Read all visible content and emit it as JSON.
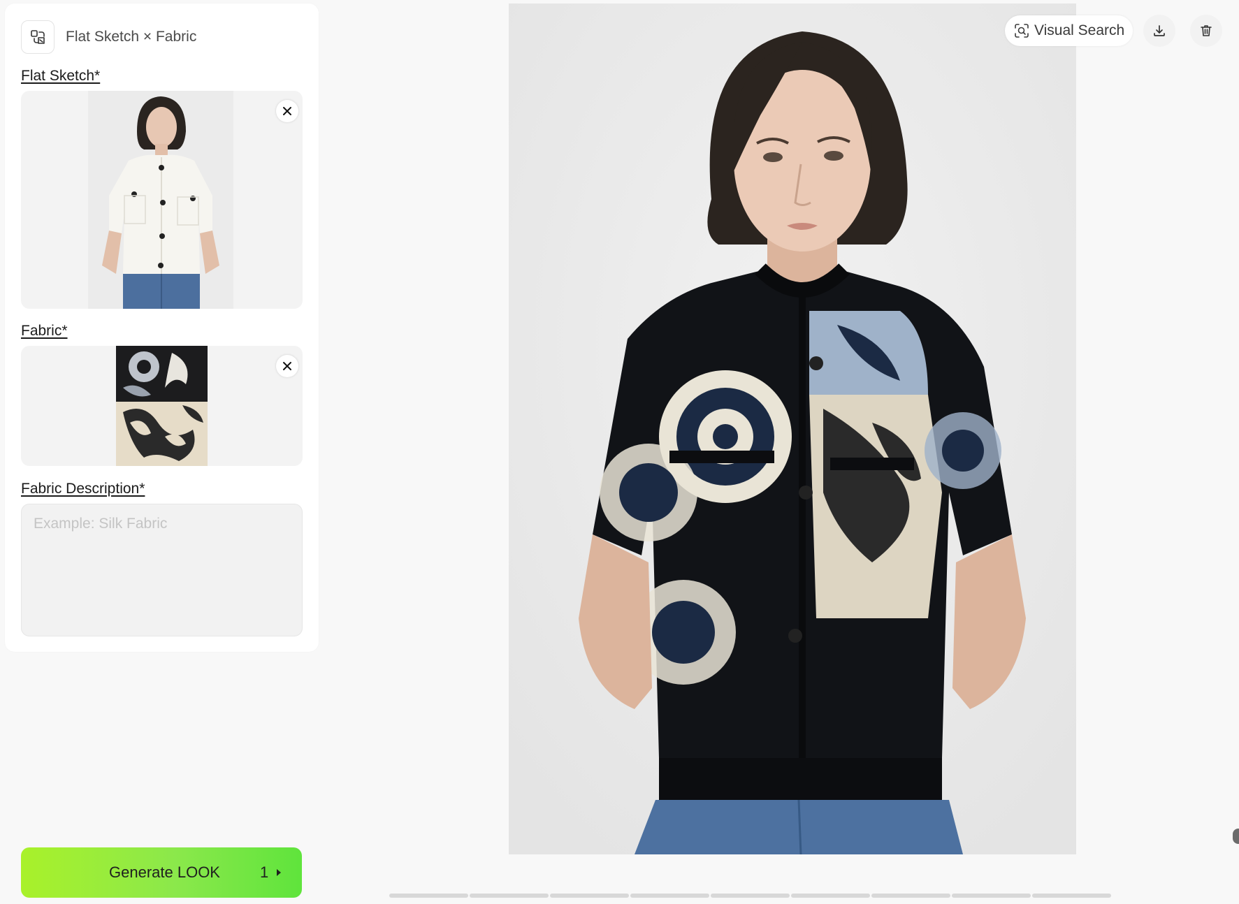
{
  "panel": {
    "title": "Flat Sketch × Fabric",
    "flat_sketch_label": "Flat Sketch*",
    "fabric_label": "Fabric*",
    "fabric_description_label": "Fabric Description*",
    "fabric_description_placeholder": "Example: Silk Fabric",
    "fabric_description_value": ""
  },
  "generate": {
    "label": "Generate LOOK",
    "count": "1"
  },
  "toolbar": {
    "visual_search_label": "Visual Search"
  },
  "colors": {
    "accent_start": "#a9f12a",
    "accent_end": "#5fe43c"
  },
  "icons": [
    "sketch-fabric-mode-icon",
    "close-icon",
    "visual-search-icon",
    "download-icon",
    "trash-icon",
    "caret-right-icon"
  ],
  "pager": {
    "segments": 9
  }
}
